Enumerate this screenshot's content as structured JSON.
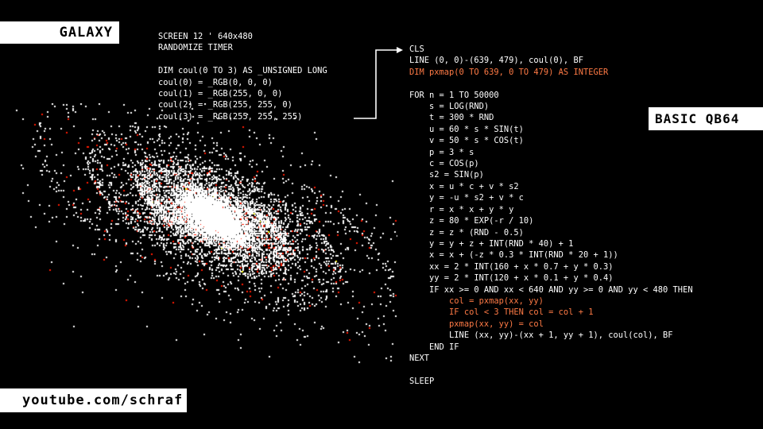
{
  "labels": {
    "title": "GALAXY",
    "language": "BASIC QB64",
    "url": "youtube.com/schraf"
  },
  "code_left": [
    {
      "text": "SCREEN 12 ' 640x480"
    },
    {
      "text": "RANDOMIZE TIMER"
    },
    {
      "text": ""
    },
    {
      "text": "DIM coul(0 TO 3) AS _UNSIGNED LONG"
    },
    {
      "text": "coul(0) = _RGB(0, 0, 0)"
    },
    {
      "text": "coul(1) = _RGB(255, 0, 0)"
    },
    {
      "text": "coul(2) = _RGB(255, 255, 0)"
    },
    {
      "text": "coul(3) = _RGB(255, 255, 255)"
    }
  ],
  "code_right": [
    {
      "text": "CLS"
    },
    {
      "text": "LINE (0, 0)-(639, 479), coul(0), BF"
    },
    {
      "text": "DIM pxmap(0 TO 639, 0 TO 479) AS INTEGER",
      "hl": true
    },
    {
      "text": ""
    },
    {
      "text": "FOR n = 1 TO 50000"
    },
    {
      "text": "    s = LOG(RND)"
    },
    {
      "text": "    t = 300 * RND"
    },
    {
      "text": "    u = 60 * s * SIN(t)"
    },
    {
      "text": "    v = 50 * s * COS(t)"
    },
    {
      "text": "    p = 3 * s"
    },
    {
      "text": "    c = COS(p)"
    },
    {
      "text": "    s2 = SIN(p)"
    },
    {
      "text": "    x = u * c + v * s2"
    },
    {
      "text": "    y = -u * s2 + v * c"
    },
    {
      "text": "    r = x * x + y * y"
    },
    {
      "text": "    z = 80 * EXP(-r / 10)"
    },
    {
      "text": "    z = z * (RND - 0.5)"
    },
    {
      "text": "    y = y + z + INT(RND * 40) + 1"
    },
    {
      "text": "    x = x + (-z * 0.3 * INT(RND * 20 + 1))"
    },
    {
      "text": "    xx = 2 * INT(160 + x * 0.7 + y * 0.3)"
    },
    {
      "text": "    yy = 2 * INT(120 + x * 0.1 + y * 0.4)"
    },
    {
      "text": "    IF xx >= 0 AND xx < 640 AND yy >= 0 AND yy < 480 THEN"
    },
    {
      "text": "        col = pxmap(xx, yy)",
      "hl": true
    },
    {
      "text": "        IF col < 3 THEN col = col + 1",
      "hl": true
    },
    {
      "text": "        pxmap(xx, yy) = col",
      "hl": true
    },
    {
      "text": "        LINE (xx, yy)-(xx + 1, yy + 1), coul(col), BF"
    },
    {
      "text": "    END IF"
    },
    {
      "text": "NEXT"
    },
    {
      "text": ""
    },
    {
      "text": "SLEEP"
    }
  ],
  "colors": {
    "background": "#000000",
    "code": "#ffffff",
    "highlight": "#ff7a45",
    "galaxy_palette": [
      "#ff1a00",
      "#ffff00",
      "#ffffff"
    ]
  }
}
